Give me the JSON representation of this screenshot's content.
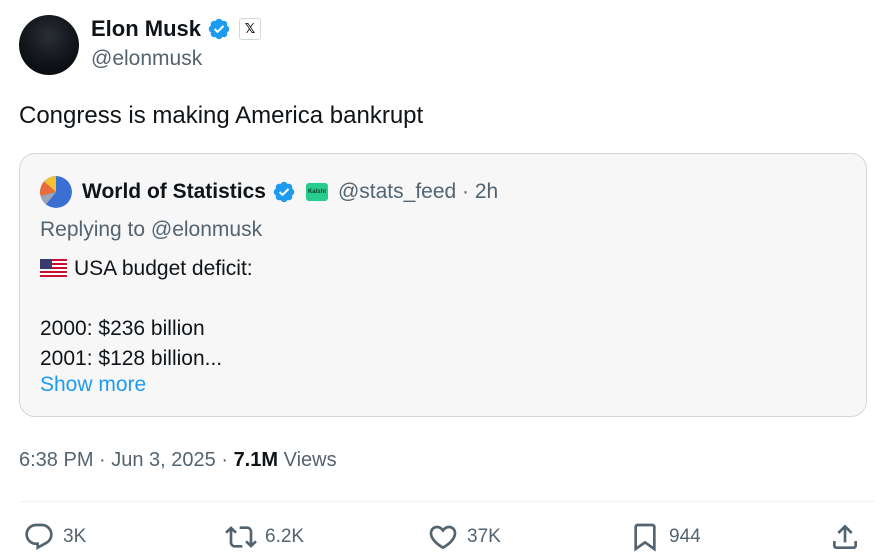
{
  "author": {
    "name": "Elon Musk",
    "handle": "@elonmusk",
    "badge_icon": "x-logo-icon",
    "verified_color": "#1d9bf0"
  },
  "tweet": {
    "text": "Congress is making America bankrupt"
  },
  "quoted": {
    "name": "World of Statistics",
    "handle_time": "@stats_feed · 2h",
    "affiliate_badge": "Kalshi",
    "reply_to": "Replying to @elonmusk",
    "lines": [
      "USA budget deficit:",
      "",
      "2000: $236 billion",
      "2001: $128 billion..."
    ],
    "flag_icon": "us-flag-icon",
    "show_more": "Show more"
  },
  "meta": {
    "time_date": "6:38 PM · Jun 3, 2025 · ",
    "views_count": "7.1M",
    "views_label": " Views"
  },
  "actions": {
    "replies": "3K",
    "reposts": "6.2K",
    "likes": "37K",
    "bookmarks": "944"
  }
}
